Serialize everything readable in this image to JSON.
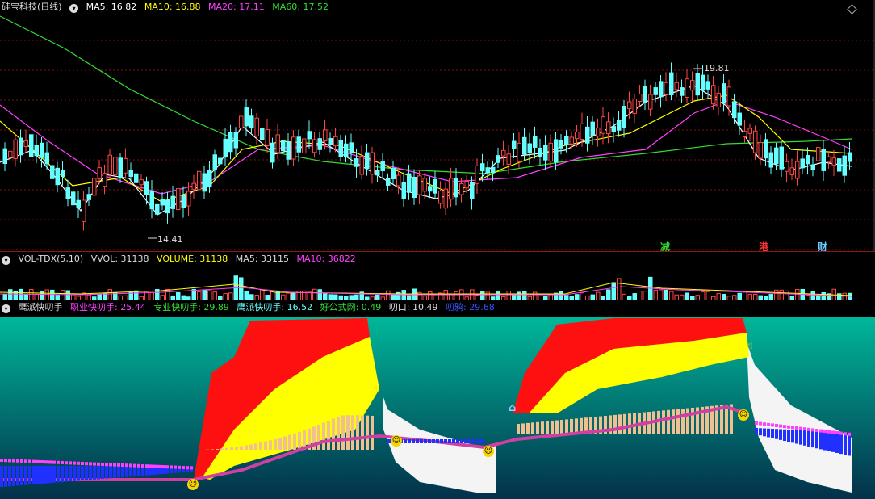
{
  "main": {
    "title": "硅宝科技(日线)",
    "ma": [
      {
        "label": "MA5: 16.82",
        "color": "#ffffff"
      },
      {
        "label": "MA10: 16.88",
        "color": "#ffff00"
      },
      {
        "label": "MA20: 17.11",
        "color": "#ff40ff"
      },
      {
        "label": "MA60: 17.52",
        "color": "#33dd33"
      }
    ],
    "high_label": "19.81",
    "low_label": "14.41",
    "markers": [
      {
        "text": "减",
        "color": "#33dd33"
      },
      {
        "text": "港",
        "color": "#ff3333"
      },
      {
        "text": "财",
        "color": "#66ccff"
      }
    ]
  },
  "vol": {
    "name": "VOL-TDX(5,10)",
    "values": [
      {
        "label": "VVOL: 31138",
        "color": "#dddddd"
      },
      {
        "label": "VOLUME: 31138",
        "color": "#ffff00"
      },
      {
        "label": "MA5: 33115",
        "color": "#dddddd"
      },
      {
        "label": "MA10: 36822",
        "color": "#ff40ff"
      }
    ]
  },
  "ind": {
    "name": "鹰派快叨手",
    "values": [
      {
        "label": "职业快叨手: 25.44",
        "color": "#ff40ff"
      },
      {
        "label": "专业快叨手: 29.89",
        "color": "#33dd33"
      },
      {
        "label": "鹰派快叨手: 16.52",
        "color": "#66ffff"
      },
      {
        "label": "好公式网: 0.49",
        "color": "#33dd33"
      },
      {
        "label": "叨口: 10.49",
        "color": "#dddddd"
      },
      {
        "label": "叨鸦: 29.68",
        "color": "#3355ff"
      }
    ]
  }
}
